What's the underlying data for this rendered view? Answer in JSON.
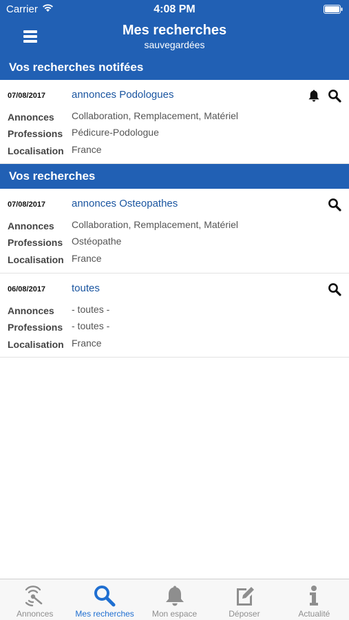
{
  "status_bar": {
    "carrier": "Carrier",
    "time": "4:08 PM"
  },
  "nav": {
    "title": "Mes recherches",
    "subtitle": "sauvegardées"
  },
  "sections": [
    {
      "title": "Vos recherches notifées",
      "items": [
        {
          "date": "07/08/2017",
          "name": "annonces Podologues",
          "notified": true,
          "rows": [
            {
              "label": "Annonces",
              "value": "Collaboration, Remplacement, Matériel"
            },
            {
              "label": "Professions",
              "value": "Pédicure-Podologue"
            },
            {
              "label": "Localisation",
              "value": "France"
            }
          ]
        }
      ]
    },
    {
      "title": "Vos recherches",
      "items": [
        {
          "date": "07/08/2017",
          "name": "annonces Osteopathes",
          "notified": false,
          "rows": [
            {
              "label": "Annonces",
              "value": "Collaboration, Remplacement, Matériel"
            },
            {
              "label": "Professions",
              "value": "Ostéopathe"
            },
            {
              "label": "Localisation",
              "value": "France"
            }
          ]
        },
        {
          "date": "06/08/2017",
          "name": "toutes",
          "notified": false,
          "rows": [
            {
              "label": "Annonces",
              "value": "- toutes -"
            },
            {
              "label": "Professions",
              "value": "- toutes -"
            },
            {
              "label": "Localisation",
              "value": "France"
            }
          ]
        }
      ]
    }
  ],
  "tabbar": {
    "tabs": [
      {
        "label": "Annonces",
        "icon": "radar-icon",
        "active": false
      },
      {
        "label": "Mes recherches",
        "icon": "search-icon",
        "active": true
      },
      {
        "label": "Mon espace",
        "icon": "bell-icon",
        "active": false
      },
      {
        "label": "Déposer",
        "icon": "edit-icon",
        "active": false
      },
      {
        "label": "Actualité",
        "icon": "info-icon",
        "active": false
      }
    ]
  },
  "colors": {
    "primary": "#2160b4",
    "link": "#1a55a0",
    "tab_active": "#1f6fd1",
    "tab_inactive": "#8e8e8e"
  }
}
